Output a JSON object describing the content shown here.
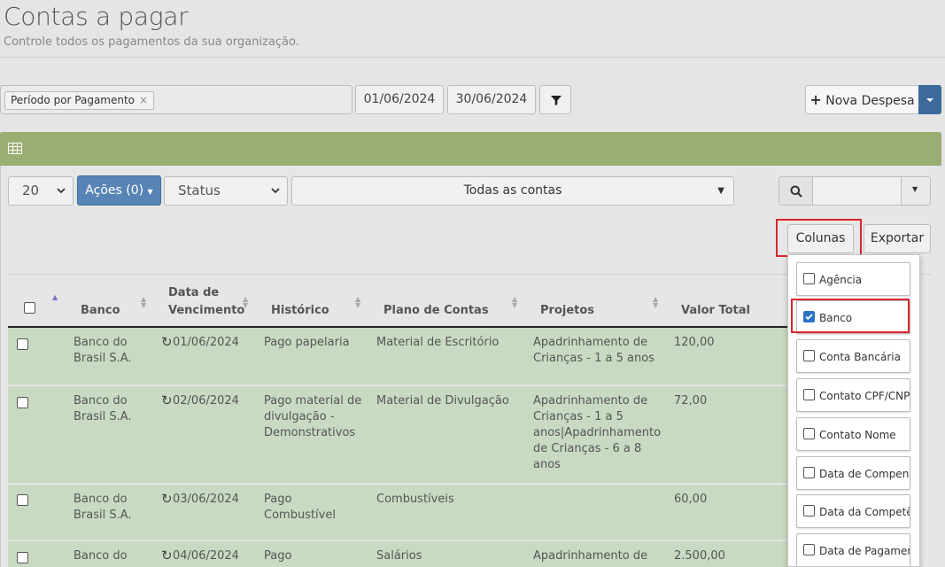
{
  "header": {
    "title": "Contas a pagar",
    "subtitle": "Controle todos os pagamentos da sua organização."
  },
  "filters": {
    "period_tag": "Período por Pagamento",
    "tag_close": "×",
    "date_start": "01/06/2024",
    "date_end": "30/06/2024",
    "new_expense_label": "Nova Despesa"
  },
  "toolbar": {
    "page_size": "20",
    "actions_label": "Ações (0)",
    "status_placeholder": "Status",
    "accounts_filter": "Todas as contas",
    "columns_label": "Colunas",
    "export_label": "Exportar"
  },
  "table": {
    "columns": [
      "Banco",
      "Data de Vencimento",
      "Histórico",
      "Plano de Contas",
      "Projetos",
      "Valor Total"
    ],
    "col_data_line1": "Data de",
    "col_data_line2": "Vencimento",
    "rows": [
      {
        "banco": "Banco do Brasil S.A.",
        "data": "01/06/2024",
        "historico": "Pago papelaria",
        "plano": "Material de Escritório",
        "projetos": "Apadrinhamento de Crianças - 1 a 5 anos",
        "valor": "120,00"
      },
      {
        "banco": "Banco do Brasil S.A.",
        "data": "02/06/2024",
        "historico": "Pago material de divulgação - Demonstrativos",
        "plano": "Material de Divulgação",
        "projetos": "Apadrinhamento de Crianças - 1 a 5 anos|Apadrinhamento de Crianças - 6 a 8 anos",
        "valor": "72,00"
      },
      {
        "banco": "Banco do Brasil S.A.",
        "data": "03/06/2024",
        "historico": "Pago Combustível",
        "plano": "Combustíveis",
        "projetos": "",
        "valor": "60,00"
      },
      {
        "banco": "Banco do",
        "data": "04/06/2024",
        "historico": "Pago",
        "plano": "Salários",
        "projetos": "Apadrinhamento de",
        "valor": "2.500,00"
      }
    ]
  },
  "columns_menu": [
    {
      "label": "Agência",
      "checked": false
    },
    {
      "label": "Banco",
      "checked": true
    },
    {
      "label": "Conta Bancária",
      "checked": false
    },
    {
      "label": "Contato CPF/CNPJ",
      "checked": false
    },
    {
      "label": "Contato Nome",
      "checked": false
    },
    {
      "label": "Data de Compensação",
      "checked": false
    },
    {
      "label": "Data da Competência",
      "checked": false
    },
    {
      "label": "Data de Pagamento",
      "checked": false
    }
  ],
  "colors": {
    "accent": "#5884b5",
    "panel_header": "#9aae73",
    "row_bg": "#c9dac2",
    "highlight": "#d9262c"
  },
  "icons": [
    "close-icon",
    "filter-icon",
    "plus-icon",
    "caret-down-icon",
    "table-icon",
    "search-icon",
    "sort-icon",
    "recurring-icon",
    "checkbox-icon"
  ]
}
